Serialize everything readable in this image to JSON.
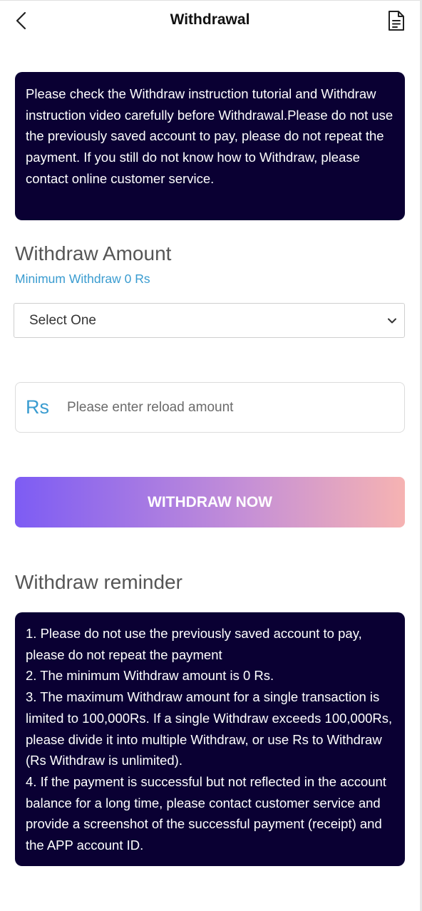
{
  "header": {
    "title": "Withdrawal",
    "back_icon": "chevron-left-icon",
    "records_icon": "document-icon"
  },
  "notice": {
    "text": "Please check the Withdraw instruction tutorial and Withdraw instruction video carefully before Withdrawal.Please do not use the previously saved account to pay, please do not repeat the payment. If you still do not know how to Withdraw, please contact online customer service."
  },
  "withdraw_amount": {
    "label": "Withdraw Amount",
    "minimum_text": "Minimum Withdraw 0 Rs",
    "select": {
      "selected": "Select One"
    }
  },
  "amount_input": {
    "currency": "Rs",
    "placeholder": "Please enter reload amount",
    "value": ""
  },
  "withdraw_button": {
    "label": "WITHDRAW NOW"
  },
  "reminder": {
    "title": "Withdraw reminder",
    "items": [
      "1. Please do not use the previously saved account to pay, please do not repeat the payment",
      "2. The minimum Withdraw amount is 0 Rs.",
      "3. The maximum Withdraw amount for a single transaction is limited to 100,000Rs. If a single Withdraw exceeds 100,000Rs, please divide it into multiple Withdraw, or use Rs to Withdraw (Rs Withdraw is unlimited).",
      "4. If the payment is successful but not reflected in the account balance for a long time, please contact customer service and provide a screenshot of the successful payment (receipt) and the APP account ID."
    ]
  },
  "colors": {
    "notice_bg": "#0a0033",
    "accent_blue": "#3a9cd0",
    "button_gradient_start": "#7d5cf4",
    "button_gradient_end": "#f6b3b2"
  }
}
